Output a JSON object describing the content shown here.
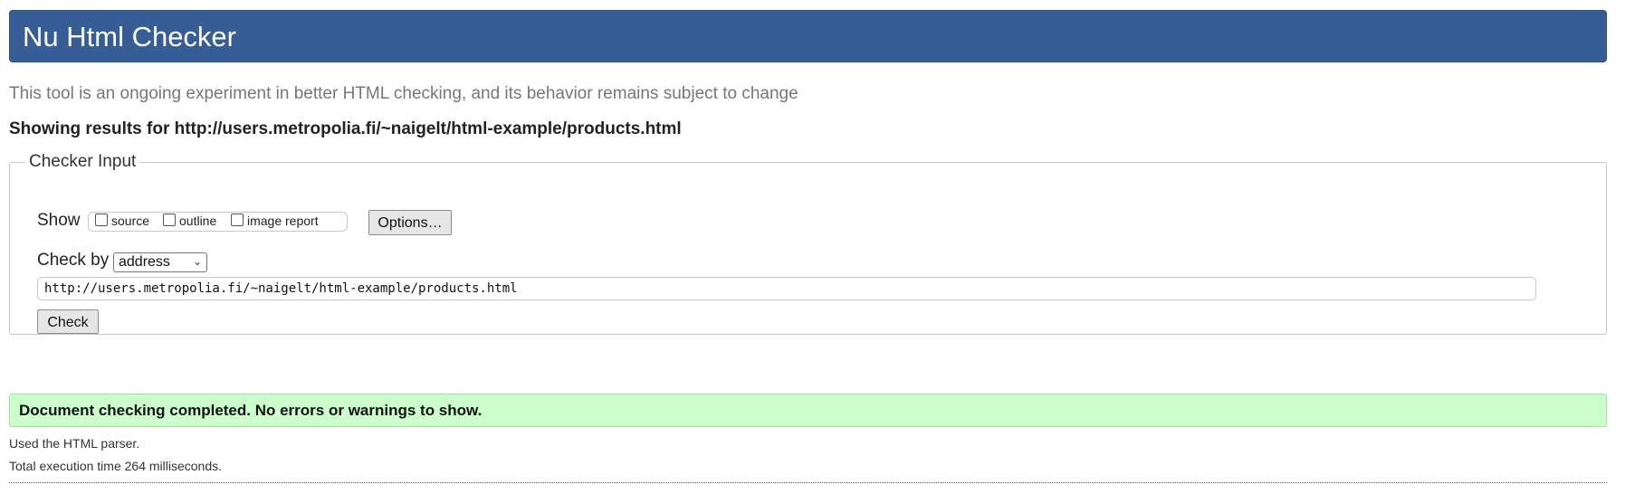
{
  "header": {
    "title": "Nu Html Checker",
    "background_color": "#365d95"
  },
  "tagline": "This tool is an ongoing experiment in better HTML checking, and its behavior remains subject to change",
  "showing_results": "Showing results for http://users.metropolia.fi/~naigelt/html-example/products.html",
  "checker_input": {
    "legend": "Checker Input",
    "show_label": "Show",
    "show_options": [
      {
        "label": "source",
        "checked": false
      },
      {
        "label": "outline",
        "checked": false
      },
      {
        "label": "image report",
        "checked": false
      }
    ],
    "options_button": "Options…",
    "check_by_label": "Check by",
    "check_by_selected": "address",
    "url_value": "http://users.metropolia.fi/~naigelt/html-example/products.html",
    "check_button": "Check"
  },
  "result": {
    "message": "Document checking completed. No errors or warnings to show.",
    "background_color": "#ccffcc",
    "parser_info": "Used the HTML parser.",
    "execution_time": "Total execution time 264 milliseconds."
  }
}
